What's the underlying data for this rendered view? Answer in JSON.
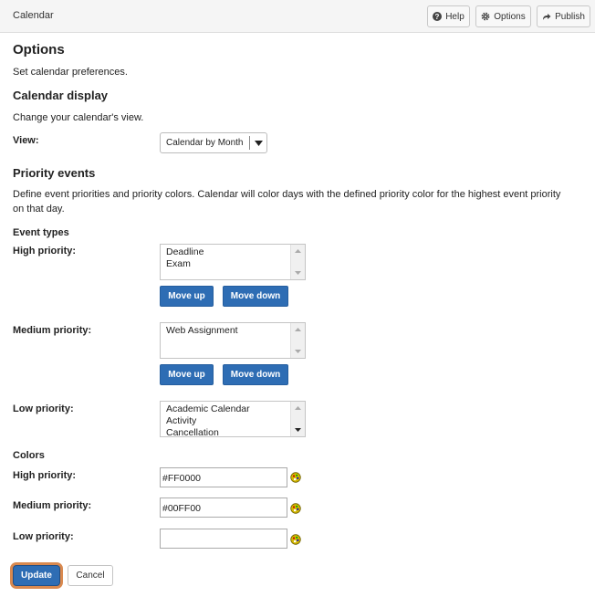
{
  "header": {
    "title": "Calendar",
    "help_label": "Help",
    "options_label": "Options",
    "publish_label": "Publish"
  },
  "page": {
    "title": "Options",
    "subtitle": "Set calendar preferences."
  },
  "display": {
    "heading": "Calendar display",
    "description": "Change your calendar's view.",
    "view_label": "View:",
    "view_value": "Calendar by Month"
  },
  "priority": {
    "heading": "Priority events",
    "description_line1": "Define event priorities and priority colors. Calendar will color days with the defined priority color for the highest event priority",
    "description_line2": "on that day.",
    "event_types_heading": "Event types",
    "high_label": "High priority:",
    "medium_label": "Medium priority:",
    "low_label": "Low priority:",
    "high_items": [
      "Deadline",
      "Exam"
    ],
    "medium_items": [
      "Web Assignment"
    ],
    "low_items": [
      "Academic Calendar",
      "Activity",
      "Cancellation"
    ],
    "move_up_label": "Move up",
    "move_down_label": "Move down"
  },
  "colors": {
    "heading": "Colors",
    "high_label": "High priority:",
    "medium_label": "Medium priority:",
    "low_label": "Low priority:",
    "high_value": "#FF0000",
    "medium_value": "#00FF00",
    "low_value": ""
  },
  "actions": {
    "update_label": "Update",
    "cancel_label": "Cancel"
  },
  "theme": {
    "primary_button": "#2e6db4",
    "focus_ring": "#d9894f",
    "palette_icon": "#d4b800"
  },
  "icons": [
    "question-circle-icon",
    "gear-icon",
    "share-arrow-icon",
    "caret-down-icon",
    "scroll-up-icon",
    "scroll-down-icon",
    "color-palette-icon"
  ]
}
